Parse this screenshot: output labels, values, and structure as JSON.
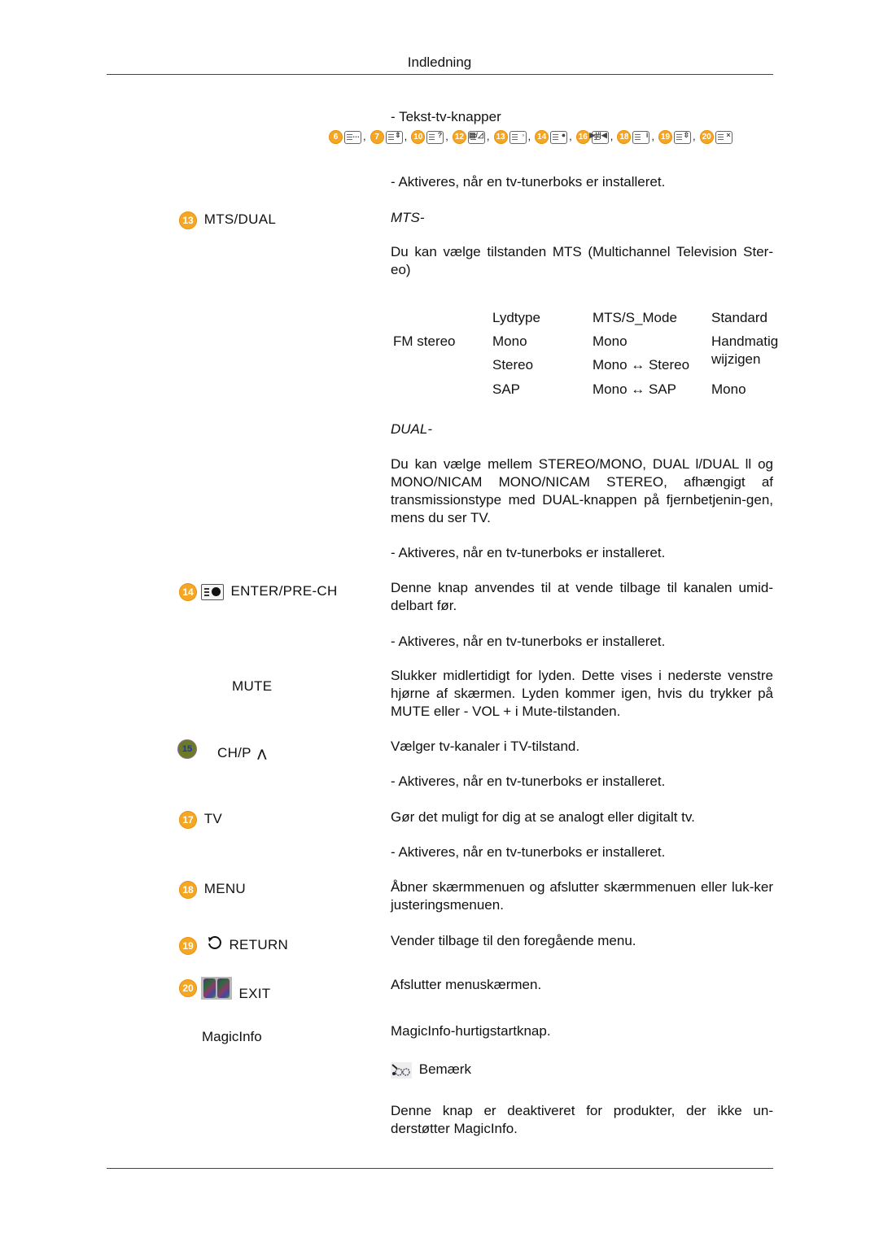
{
  "header": {
    "title": "Indledning"
  },
  "teletext": {
    "heading": "- Tekst-tv-knapper",
    "buttons": [
      {
        "num": "6",
        "glyph": "…"
      },
      {
        "num": "7",
        "glyph": "⇕"
      },
      {
        "num": "10",
        "glyph": "?"
      },
      {
        "num": "12",
        "glyph": "▤/◿"
      },
      {
        "num": "13",
        "glyph": "◦"
      },
      {
        "num": "14",
        "glyph": "●"
      },
      {
        "num": "16",
        "glyph": "▶|/|◀"
      },
      {
        "num": "18",
        "glyph": "i"
      },
      {
        "num": "19",
        "glyph": "⇳"
      },
      {
        "num": "20",
        "glyph": "×"
      }
    ],
    "separator": ","
  },
  "items": {
    "mts_dual": {
      "num": "13",
      "label": "MTS/DUAL",
      "note": "- Aktiveres, når en tv-tunerboks er installeret.",
      "mts_heading": "MTS-",
      "mts_text": "Du kan vælge tilstanden MTS (Multichannel Television Ster-eo)",
      "dual_heading": "DUAL-",
      "dual_text": "Du kan vælge mellem STEREO/MONO, DUAL l/DUAL ll og MONO/NICAM MONO/NICAM STEREO, afhængigt af transmissionstype med DUAL-knappen på fjernbetjenin-gen, mens du ser TV.",
      "dual_note": "- Aktiveres, når en tv-tunerboks er installeret."
    },
    "enter": {
      "num": "14",
      "label": "ENTER/PRE-CH",
      "text": "Denne knap anvendes til at vende tilbage til kanalen umid-delbart før.",
      "note": "- Aktiveres, når en tv-tunerboks er installeret."
    },
    "mute": {
      "label": "MUTE",
      "text": "Slukker midlertidigt for lyden. Dette vises i nederste venstre hjørne af skærmen. Lyden kommer igen, hvis du trykker på MUTE eller - VOL + i Mute-tilstanden."
    },
    "chp": {
      "num": "15",
      "label": "CH/P",
      "arrow": "⋀",
      "text": "Vælger tv-kanaler i TV-tilstand.",
      "note": "- Aktiveres, når en tv-tunerboks er installeret."
    },
    "tv": {
      "num": "17",
      "label": "TV",
      "text": "Gør det muligt for dig at se analogt eller digitalt tv.",
      "note": "- Aktiveres, når en tv-tunerboks er installeret."
    },
    "menu": {
      "num": "18",
      "label": "MENU",
      "text": "Åbner skærmmenuen og afslutter skærmmenuen eller luk-ker justeringsmenuen."
    },
    "return": {
      "num": "19",
      "label": "RETURN",
      "text": "Vender tilbage til den foregående menu."
    },
    "exit": {
      "num": "20",
      "label": "EXIT",
      "text": "Afslutter menuskærmen."
    },
    "magicinfo": {
      "label": "MagicInfo",
      "text_bold": "MagicInfo",
      "text_rest": "-hurtigstartknap.",
      "note_title": "Bemærk",
      "note_text_pre": "Denne knap er deaktiveret for produkter, der ikke un-derstøtter ",
      "note_text_bold": "MagicInfo",
      "note_text_post": "."
    }
  },
  "mts_table": {
    "headers": [
      "",
      "Lydtype",
      "MTS/S_Mode",
      "Standard"
    ],
    "rows": [
      [
        "FM stereo",
        "Mono",
        "Mono",
        "Handmatig wijzigen"
      ],
      [
        "",
        "Stereo",
        "Mono ↔ Stereo",
        ""
      ],
      [
        "",
        "SAP",
        "Mono ↔ SAP",
        "Mono"
      ]
    ]
  }
}
